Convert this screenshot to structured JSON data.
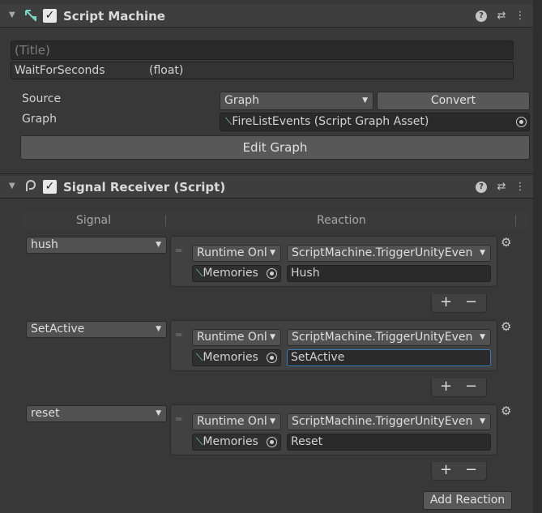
{
  "script_machine": {
    "title": "Script Machine",
    "title_placeholder": "(Title)",
    "graph_name": "WaitForSeconds",
    "graph_type": "(float)",
    "source_label": "Source",
    "source_value": "Graph",
    "convert_label": "Convert",
    "graph_label": "Graph",
    "graph_asset": "FireListEvents (Script Graph Asset)",
    "edit_graph_label": "Edit Graph"
  },
  "signal_receiver": {
    "title": "Signal Receiver (Script)",
    "col_signal": "Signal",
    "col_reaction": "Reaction",
    "reactions": [
      {
        "signal": "hush",
        "runtime": "Runtime Onl",
        "method": "ScriptMachine.TriggerUnityEven",
        "object": "Memories",
        "argument": "Hush"
      },
      {
        "signal": "SetActive",
        "runtime": "Runtime Onl",
        "method": "ScriptMachine.TriggerUnityEven",
        "object": "Memories",
        "argument": "SetActive"
      },
      {
        "signal": "reset",
        "runtime": "Runtime Onl",
        "method": "ScriptMachine.TriggerUnityEven",
        "object": "Memories",
        "argument": "Reset"
      }
    ],
    "add_reaction_label": "Add Reaction"
  },
  "icons": {
    "help": "?",
    "presets": "⇄",
    "more": "⋮",
    "fold": "▼",
    "check": "✓",
    "plus": "+",
    "minus": "−",
    "gear": "⚙"
  },
  "colors": {
    "background": "#383838",
    "field": "#2a2a2a",
    "focus": "#3a79bb",
    "object_icon": "#7ed4c4"
  }
}
